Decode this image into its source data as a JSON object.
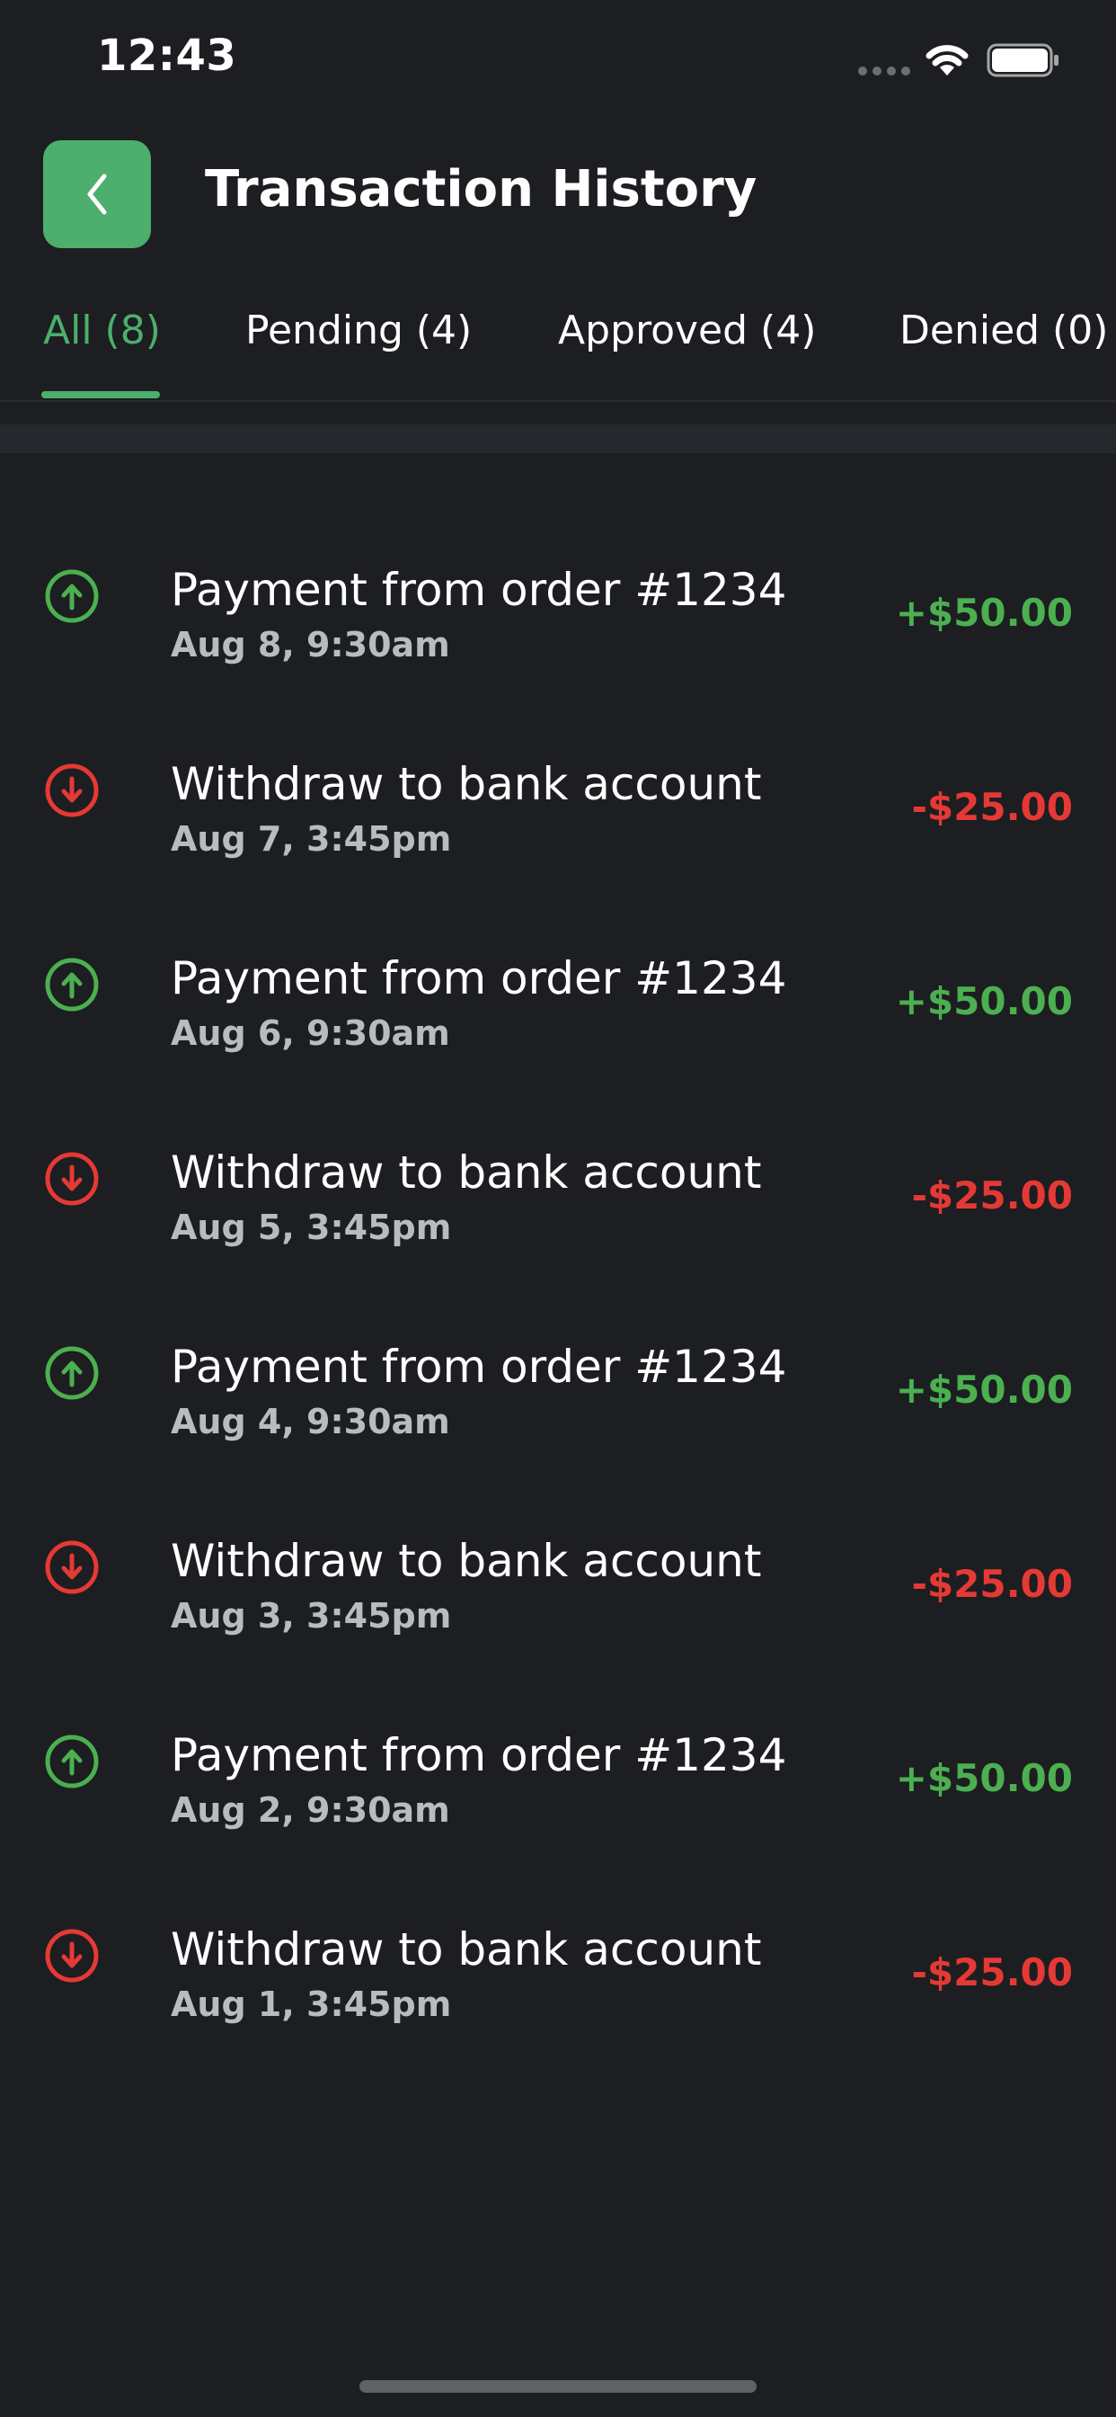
{
  "status_bar": {
    "time": "12:43",
    "signal_icon": "signal-dots-icon",
    "wifi_icon": "wifi-icon",
    "battery_icon": "battery-icon"
  },
  "header": {
    "back_icon": "chevron-left-icon",
    "title": "Transaction History"
  },
  "tabs": [
    {
      "label": "All (8)",
      "active": true
    },
    {
      "label": "Pending (4)",
      "active": false
    },
    {
      "label": "Approved (4)",
      "active": false
    },
    {
      "label": "Denied (0)",
      "active": false
    }
  ],
  "transactions": [
    {
      "type": "credit",
      "icon": "arrow-up-circle-icon",
      "title": "Payment from order #1234",
      "date": "Aug 8, 9:30am",
      "amount": "+$50.00"
    },
    {
      "type": "debit",
      "icon": "arrow-down-circle-icon",
      "title": "Withdraw to bank account",
      "date": "Aug 7, 3:45pm",
      "amount": "-$25.00"
    },
    {
      "type": "credit",
      "icon": "arrow-up-circle-icon",
      "title": "Payment from order #1234",
      "date": "Aug 6, 9:30am",
      "amount": "+$50.00"
    },
    {
      "type": "debit",
      "icon": "arrow-down-circle-icon",
      "title": "Withdraw to bank account",
      "date": "Aug 5, 3:45pm",
      "amount": "-$25.00"
    },
    {
      "type": "credit",
      "icon": "arrow-up-circle-icon",
      "title": "Payment from order #1234",
      "date": "Aug 4, 9:30am",
      "amount": "+$50.00"
    },
    {
      "type": "debit",
      "icon": "arrow-down-circle-icon",
      "title": "Withdraw to bank account",
      "date": "Aug 3, 3:45pm",
      "amount": "-$25.00"
    },
    {
      "type": "credit",
      "icon": "arrow-up-circle-icon",
      "title": "Payment from order #1234",
      "date": "Aug 2, 9:30am",
      "amount": "+$50.00"
    },
    {
      "type": "debit",
      "icon": "arrow-down-circle-icon",
      "title": "Withdraw to bank account",
      "date": "Aug 1, 3:45pm",
      "amount": "-$25.00"
    }
  ],
  "colors": {
    "background": "#1c1e21",
    "accent": "#4caf6d",
    "credit": "#4caf50",
    "debit": "#e53935",
    "secondary_text": "#b9bbbe"
  }
}
